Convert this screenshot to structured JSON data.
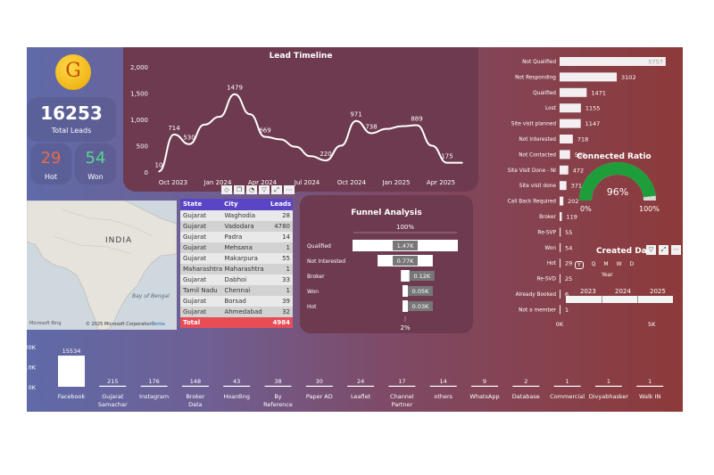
{
  "kpis": {
    "total_value": "16253",
    "total_label": "Total Leads",
    "hot_value": "29",
    "hot_label": "Hot",
    "won_value": "54",
    "won_label": "Won",
    "hot_color": "#e86a4a",
    "won_color": "#58d68d"
  },
  "map": {
    "country_label": "INDIA",
    "sea_label": "Bay of Bengal",
    "provider": "Microsoft Bing",
    "copyright": "© 2025 Microsoft Corporation",
    "terms": "Terms"
  },
  "table": {
    "headers": [
      "State",
      "City",
      "Leads"
    ],
    "rows": [
      [
        "Gujarat",
        "Waghodia",
        "28"
      ],
      [
        "Gujarat",
        "Vadodara",
        "4780"
      ],
      [
        "Gujarat",
        "Padra",
        "14"
      ],
      [
        "Gujarat",
        "Mehsana",
        "1"
      ],
      [
        "Gujarat",
        "Makarpura",
        "55"
      ],
      [
        "Maharashtra",
        "Maharashtra",
        "1"
      ],
      [
        "Gujarat",
        "Dabhoi",
        "33"
      ],
      [
        "Tamil Nadu",
        "Chennai",
        "1"
      ],
      [
        "Gujarat",
        "Borsad",
        "39"
      ],
      [
        "Gujarat",
        "Ahmedabad",
        "32"
      ]
    ],
    "total_label": "Total",
    "total_value": "4984"
  },
  "gauge": {
    "title": "Connected Ratio",
    "value_label": "96%",
    "value": 0.96,
    "min_label": "0%",
    "max_label": "100%",
    "color": "#1e9e3a"
  },
  "date_slicer": {
    "title": "Created Date",
    "granularity": [
      "Y",
      "Q",
      "M",
      "W",
      "D"
    ],
    "selected": "Y",
    "level_label": "Year",
    "years": [
      "2023",
      "2024",
      "2025"
    ]
  },
  "chart_data": [
    {
      "type": "line",
      "title": "Lead Timeline",
      "y_ticks": [
        "0",
        "500",
        "1,000",
        "1,500",
        "2,000"
      ],
      "ylim": [
        0,
        2000
      ],
      "x_ticks": [
        "Oct 2023",
        "Jan 2024",
        "Apr 2024",
        "Jul 2024",
        "Oct 2024",
        "Jan 2025",
        "Apr 2025"
      ],
      "x": [
        0,
        1,
        2,
        3,
        4,
        5,
        6,
        7,
        8,
        9,
        10,
        11,
        12,
        13,
        14,
        15,
        16,
        17,
        18,
        19,
        20
      ],
      "values": [
        10,
        714,
        530,
        900,
        1050,
        1479,
        1100,
        669,
        620,
        480,
        300,
        220,
        500,
        971,
        738,
        820,
        870,
        889,
        500,
        175,
        175
      ],
      "labels": [
        {
          "i": 0,
          "text": "10"
        },
        {
          "i": 1,
          "text": "714"
        },
        {
          "i": 2,
          "text": "530"
        },
        {
          "i": 5,
          "text": "1479"
        },
        {
          "i": 7,
          "text": "669"
        },
        {
          "i": 11,
          "text": "220"
        },
        {
          "i": 13,
          "text": "971"
        },
        {
          "i": 14,
          "text": "738"
        },
        {
          "i": 17,
          "text": "889"
        },
        {
          "i": 19,
          "text": "175"
        }
      ]
    },
    {
      "type": "bar",
      "orientation": "horizontal",
      "categories": [
        "Not Qualified",
        "Not Responding",
        "Qualified",
        "Lost",
        "Site visit planned",
        "Not Interested",
        "Not Contacted",
        "Site Visit Done - NI",
        "Site visit done",
        "Call Back Required",
        "Broker",
        "Re-SVP",
        "Won",
        "Hot",
        "Re-SVD",
        "Already Booked",
        "Not a member"
      ],
      "values": [
        5757,
        3102,
        1471,
        1155,
        1147,
        718,
        569,
        472,
        371,
        202,
        119,
        55,
        54,
        29,
        25,
        6,
        1
      ],
      "value_labels": [
        "5757",
        "3102",
        "1471",
        "1155",
        "1147",
        "718",
        "569",
        "472",
        "371",
        "202",
        "119",
        "55",
        "54",
        "29",
        "25",
        "6",
        "1"
      ],
      "x_ticks": [
        "0K",
        "5K"
      ],
      "xlim": [
        0,
        6200
      ]
    },
    {
      "type": "bar",
      "title": "Funnel Analysis",
      "categories": [
        "Qualified",
        "Not Interested",
        "Broker",
        "Won",
        "Hot"
      ],
      "values": [
        1470,
        770,
        120,
        50,
        30
      ],
      "value_labels": [
        "1.47K",
        "0.77K",
        "0.12K",
        "0.05K",
        "0.03K"
      ],
      "top_label": "100%",
      "bottom_label": "2%"
    },
    {
      "type": "bar",
      "categories": [
        "Facebook",
        "Gujarat Samachar",
        "Instagram",
        "Broker Data",
        "Hoarding",
        "By Reference",
        "Paper AD",
        "Leaflet",
        "Channel Partner",
        "others",
        "WhatsApp",
        "Database",
        "Commercial",
        "Divyabhasker",
        "Walk IN"
      ],
      "values": [
        15534,
        215,
        176,
        148,
        43,
        38,
        30,
        24,
        17,
        14,
        9,
        2,
        1,
        1,
        1
      ],
      "value_labels": [
        "15534",
        "215",
        "176",
        "148",
        "43",
        "38",
        "30",
        "24",
        "17",
        "14",
        "9",
        "2",
        "1",
        "1",
        "1"
      ],
      "y_ticks": [
        "0K",
        "10K",
        "20K"
      ],
      "ylim": [
        0,
        20000
      ]
    }
  ]
}
